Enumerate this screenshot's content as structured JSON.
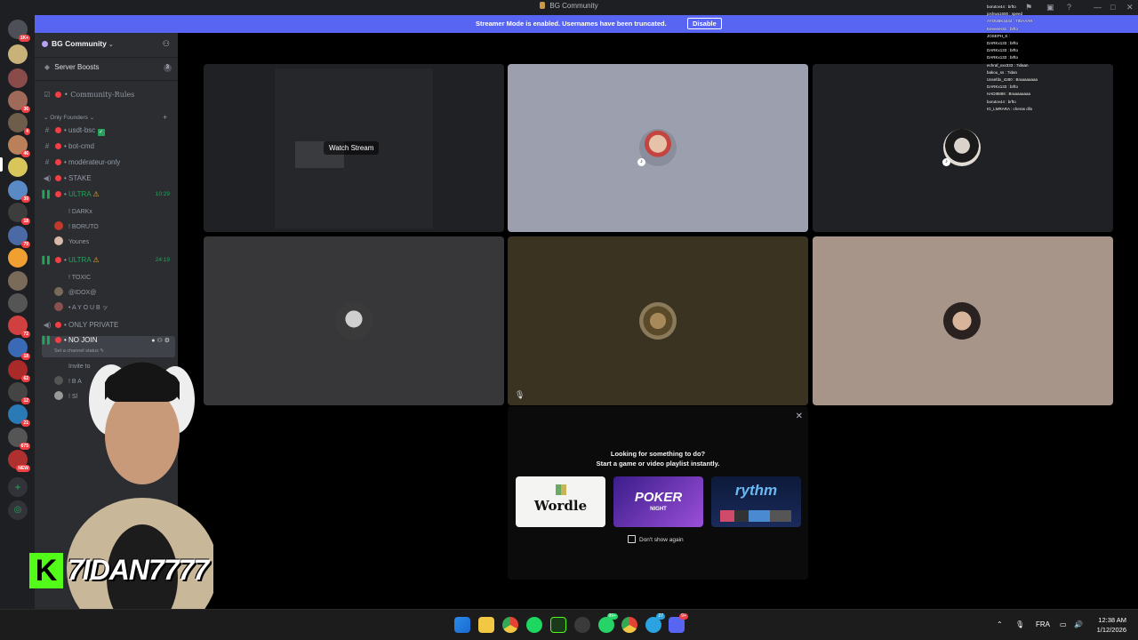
{
  "window": {
    "title": "BG Community"
  },
  "banner": {
    "message": "Streamer Mode is enabled. Usernames have been truncated.",
    "button": "Disable"
  },
  "server": {
    "name": "BG Community"
  },
  "sidebar": {
    "boosts": {
      "label": "Server Boosts",
      "count": "3"
    },
    "rules": "Community-Rules",
    "category": "Only Founders",
    "channels": [
      {
        "name": "usdt-bsc",
        "type": "text"
      },
      {
        "name": "bot-cmd",
        "type": "text"
      },
      {
        "name": "modérateur-only",
        "type": "text"
      },
      {
        "name": "STAKE",
        "type": "voice"
      },
      {
        "name": "ULTRA",
        "type": "voice",
        "time": "10:29"
      },
      {
        "name": "ULTRA",
        "type": "voice",
        "time": "24:19"
      },
      {
        "name": "ONLY PRIVATE",
        "type": "voice"
      },
      {
        "name": "NO JOIN",
        "type": "voice"
      }
    ],
    "ultra1_users": [
      "! DARKx",
      "! BORUTO",
      "Younes"
    ],
    "ultra2_users": [
      "! TOXIC",
      "@IDOX@",
      "• A Y O U B ッ"
    ],
    "nojoin_status": "Set a channel status",
    "nojoin_users": [
      "Invite to",
      "! B A",
      "! Sl"
    ]
  },
  "rail": {
    "badges": [
      "1K+",
      "36",
      "4",
      "46",
      "39",
      "18",
      "79",
      "72",
      "18",
      "62",
      "12",
      "21",
      "675",
      "NEW"
    ]
  },
  "main": {
    "watch_stream": "Watch Stream",
    "activity": {
      "line1": "Looking for something to do?",
      "line2": "Start a game or video playlist instantly.",
      "cards": [
        "Wordle",
        "POKER",
        "rythm"
      ],
      "poker_sub": "NIGHT",
      "dont_show": "Don't show again"
    }
  },
  "chat": [
    "borutov44 : brfto",
    "joshwa1600 : speed",
    "AYOUBK4444 : 7IDAAAR",
    "Eeeeeesss : brfto",
    "JOSEPH_K :",
    "DARKx133 : brfto",
    "DARKx133 : brfto",
    "DARKx133 : brfto",
    "echraf_xxx333 : 7idaan",
    "bakou_ss : 7idan",
    "Ussefdx_4280 : Braaaaaaaa",
    "DARKx133 : brfto",
    "HADI8888 : Braaaaaaaa",
    "borutov44 : brfto",
    "IG_LMRARA : cheras dllo"
  ],
  "overlay": {
    "k": "K",
    "streamer": "7IDAN7777"
  },
  "taskbar": {
    "lang": "FRA",
    "time": "12:38 AM",
    "date": "1/12/2026",
    "whatsapp_badge": "99+",
    "telegram_badge": "27",
    "discord_badge": "9+"
  }
}
